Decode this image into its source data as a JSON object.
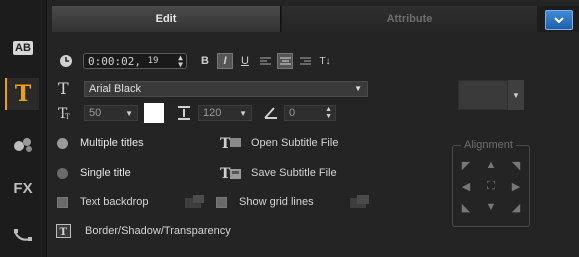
{
  "sidebar": {
    "items": [
      {
        "icon": "ab-icon",
        "text": "AB"
      },
      {
        "icon": "title-t-icon",
        "text": "T"
      },
      {
        "icon": "particle-icon",
        "text": ""
      },
      {
        "icon": "fx-icon",
        "text": "FX"
      },
      {
        "icon": "motion-path-icon",
        "text": ""
      }
    ]
  },
  "tabs": {
    "edit": "Edit",
    "attribute": "Attribute"
  },
  "timecode": {
    "value": "0:00:02",
    "frames": "19"
  },
  "format": {
    "bold": "B",
    "italic": "I",
    "underline": "U",
    "superscript": "T↓"
  },
  "font": {
    "family": "Arial Black",
    "size": "50",
    "line_spacing": "120",
    "angle": "0"
  },
  "options": {
    "multiple_titles": "Multiple titles",
    "single_title": "Single title",
    "text_backdrop": "Text backdrop",
    "open_subtitle": "Open Subtitle File",
    "save_subtitle": "Save Subtitle File",
    "show_grid": "Show grid lines",
    "border_shadow": "Border/Shadow/Transparency"
  },
  "alignment": {
    "title": "Alignment"
  },
  "colors": {
    "accent": "#f0a10a",
    "font_color": "#ffffff",
    "tab_button": "#2f73c4"
  }
}
